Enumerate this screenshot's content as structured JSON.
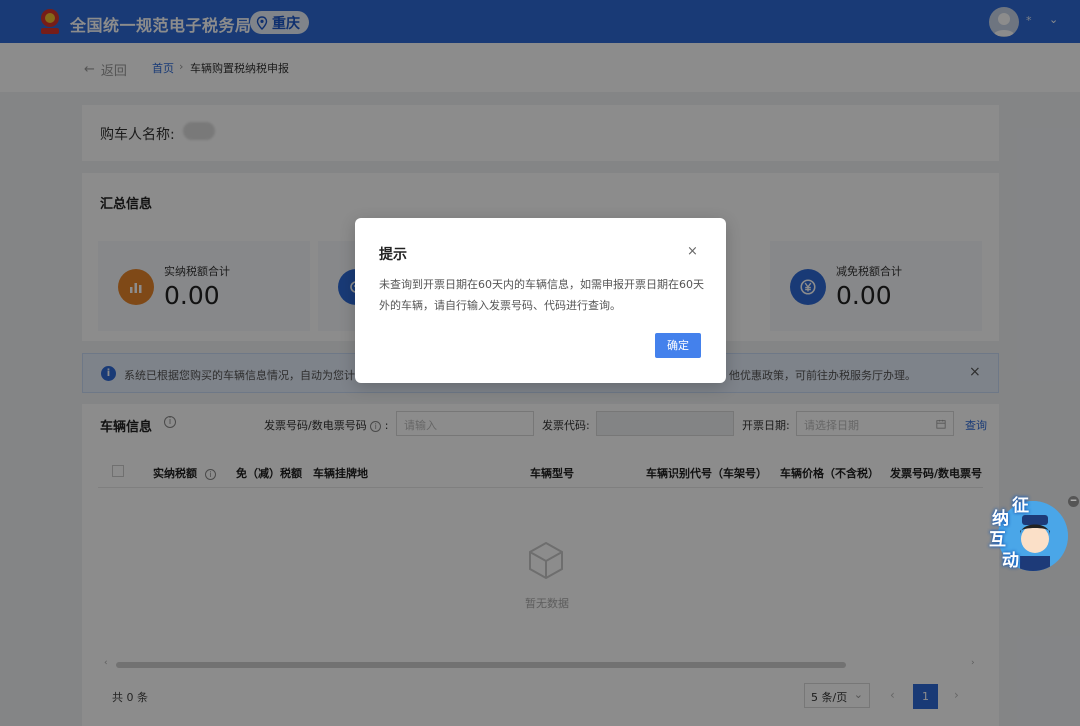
{
  "header": {
    "site_title": "全国统一规范电子税务局",
    "region": "重庆",
    "user_name": "*",
    "caret": "⌄"
  },
  "breadcrumb": {
    "back": "返回",
    "home": "首页",
    "separator": "›",
    "current": "车辆购置税纳税申报"
  },
  "buyer": {
    "label": "购车人名称:"
  },
  "summary": {
    "title": "汇总信息",
    "stats": [
      {
        "label": "实纳税额合计",
        "value": "0.00",
        "icon": "bar-chart-icon",
        "color": "#e8852a"
      },
      {
        "label": "",
        "value": "",
        "icon": "tax-icon",
        "color": "#2f6bd8"
      },
      {
        "label": "减免税额合计",
        "value": "0.00",
        "icon": "yuan-icon",
        "color": "#2f6bd8"
      }
    ]
  },
  "banner": {
    "icon": "i",
    "text_left": "系统已根据您购买的车辆信息情况，自动为您计",
    "text_right": "他优惠政策，可前往办税服务厅办理。",
    "close": "×"
  },
  "vehicle": {
    "title": "车辆信息",
    "help": "i",
    "filters": {
      "invoice_no_label": "发票号码/数电票号码",
      "invoice_no_placeholder": "请输入",
      "invoice_code_label": "发票代码:",
      "invoice_date_label": "开票日期:",
      "invoice_date_placeholder": "请选择日期",
      "query": "查询"
    },
    "columns": [
      "实纳税额",
      "免（减）税额",
      "车辆挂牌地",
      "车辆型号",
      "车辆识别代号（车架号）",
      "车辆价格（不含税）",
      "发票号码/数电票号"
    ],
    "empty_text": "暂无数据",
    "total": "共 0 条",
    "page_size": "5 条/页",
    "current_page": "1"
  },
  "modal": {
    "title": "提示",
    "close": "×",
    "body": "未查询到开票日期在60天内的车辆信息，如需申报开票日期在60天外的车辆，请自行输入发票号码、代码进行查询。",
    "ok": "确定"
  },
  "assistant": {
    "chars": [
      "征",
      "纳",
      "互",
      "动"
    ],
    "minimize": "−"
  },
  "colors": {
    "brand": "#2f6bd8",
    "orange": "#e8852a",
    "mask": "rgba(0,0,0,0.45)"
  }
}
